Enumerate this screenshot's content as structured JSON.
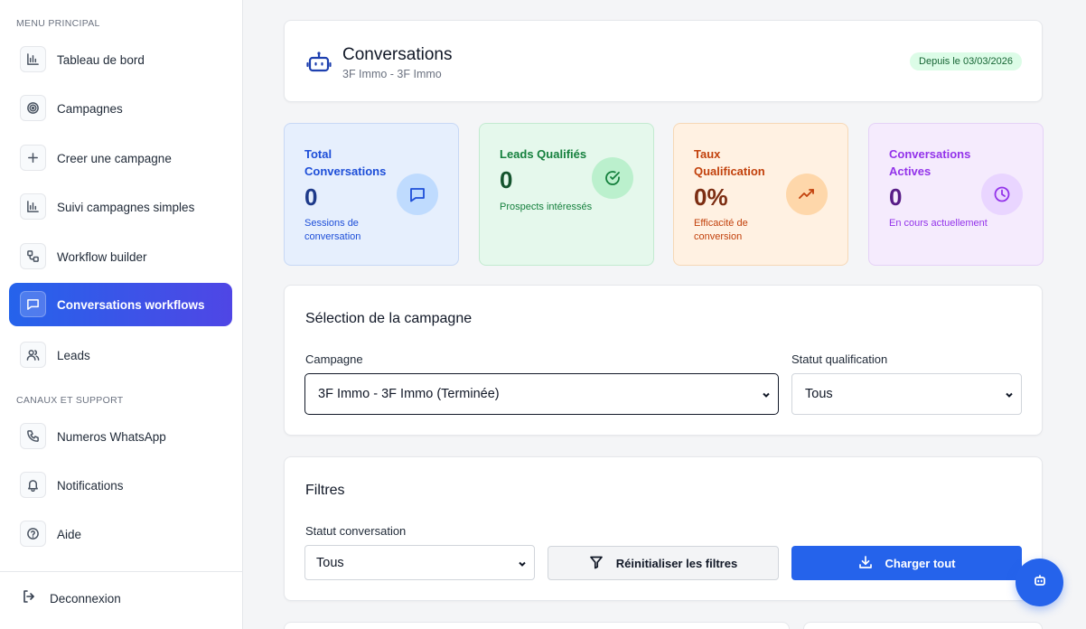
{
  "sidebar": {
    "section_main": "MENU PRINCIPAL",
    "section_support": "CANAUX ET SUPPORT",
    "items": [
      {
        "label": "Tableau de bord",
        "icon": "bar-chart-icon"
      },
      {
        "label": "Campagnes",
        "icon": "target-icon"
      },
      {
        "label": "Creer une campagne",
        "icon": "plus-icon"
      },
      {
        "label": "Suivi campagnes simples",
        "icon": "bar-chart-icon"
      },
      {
        "label": "Workflow builder",
        "icon": "workflow-icon"
      },
      {
        "label": "Conversations workflows",
        "icon": "message-icon",
        "active": true
      },
      {
        "label": "Leads",
        "icon": "users-icon"
      }
    ],
    "support_items": [
      {
        "label": "Numeros WhatsApp",
        "icon": "phone-icon"
      },
      {
        "label": "Notifications",
        "icon": "bell-icon"
      },
      {
        "label": "Aide",
        "icon": "help-icon"
      }
    ],
    "logout_label": "Deconnexion",
    "active_color": "#2563eb"
  },
  "header": {
    "title": "Conversations",
    "subtitle": "3F Immo - 3F Immo",
    "badge": "Depuis le 03/03/2026",
    "icon": "robot-icon"
  },
  "stats": [
    {
      "title": "Total Conversations",
      "value": "0",
      "desc": "Sessions de conversation",
      "icon": "message-icon",
      "color": "#1e3a8a"
    },
    {
      "title": "Leads Qualifiés",
      "value": "0",
      "desc": "Prospects intéressés",
      "icon": "check-circle-icon",
      "color": "#15803d"
    },
    {
      "title": "Taux Qualification",
      "value": "0%",
      "desc": "Efficacité de conversion",
      "icon": "trending-up-icon",
      "color": "#c2410c"
    },
    {
      "title": "Conversations Actives",
      "value": "0",
      "desc": "En cours actuellement",
      "icon": "clock-icon",
      "color": "#7e22ce"
    }
  ],
  "campaign_selection": {
    "title": "Sélection de la campagne",
    "campaign_label": "Campagne",
    "campaign_value": "3F Immo - 3F Immo (Terminée)",
    "status_label": "Statut qualification",
    "status_value": "Tous"
  },
  "filters": {
    "title": "Filtres",
    "status_label": "Statut conversation",
    "status_value": "Tous",
    "reset_label": "Réinitialiser les filtres",
    "load_label": "Charger tout"
  },
  "fab_icon": "robot-icon"
}
